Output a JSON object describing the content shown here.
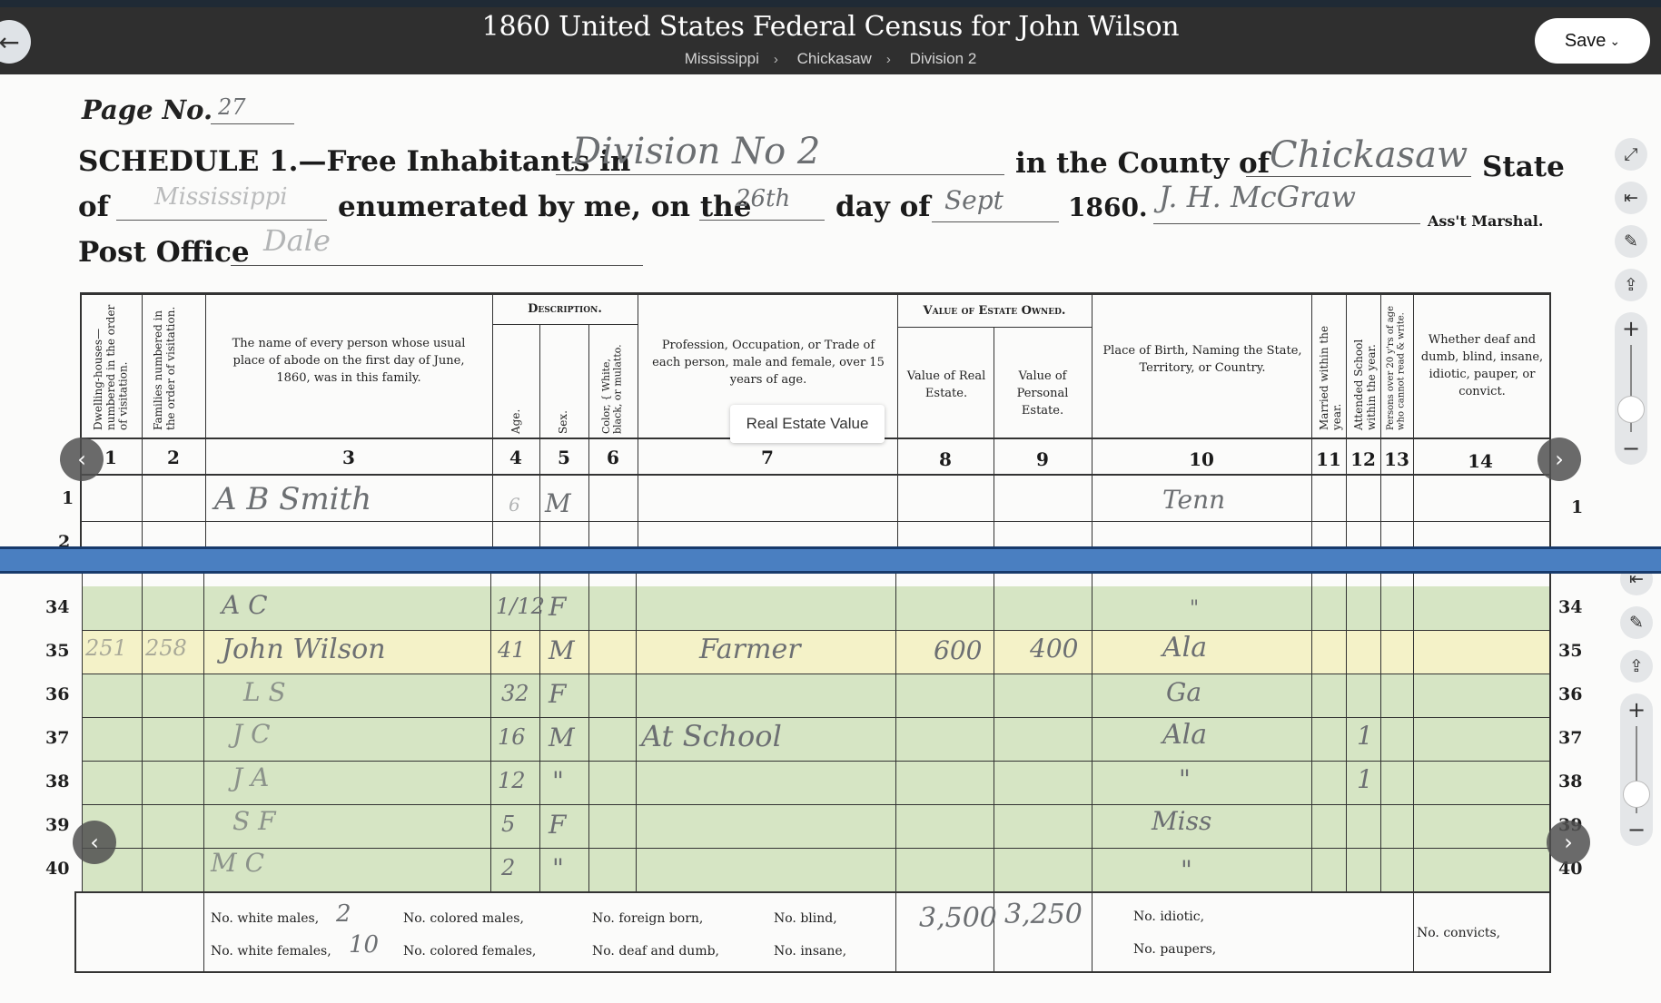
{
  "header": {
    "title": "1860 United States Federal Census for John Wilson",
    "breadcrumbs": [
      "Mississippi",
      "Chickasaw",
      "Division 2"
    ],
    "save_label": "Save",
    "back_icon": "arrow-left-icon"
  },
  "tooltip": "Real Estate Value",
  "document": {
    "page_label": "Page No.",
    "page_value": "27",
    "schedule_prefix": "SCHEDULE 1.—Free Inhabitants in",
    "division": "Division No 2",
    "county_label": "in the County of",
    "county": "Chickasaw",
    "state_label": "State",
    "of_label": "of",
    "state": "Mississippi",
    "enumerated_label": "enumerated by me, on the",
    "day": "26th",
    "day_label": "day of",
    "month": "Sept",
    "year": "1860.",
    "marshal": "J. H. McGraw",
    "marshal_label": "Ass't Marshal.",
    "post_office_label": "Post Office",
    "post_office": "Dale",
    "group_description": "Description.",
    "group_value": "Value of Estate Owned.",
    "col_headers": {
      "c1": "Dwelling-houses— numbered in the order of visitation.",
      "c2": "Families numbered in the order of visitation.",
      "c3": "The name of every person whose usual place of abode on the first day of June, 1860, was in this family.",
      "c4": "Age.",
      "c5": "Sex.",
      "c6": "Color, { White, black, or mulatto.",
      "c7": "Profession, Occupation, or Trade of each person, male and female, over 15 years of age.",
      "c8": "Value of Real Estate.",
      "c9": "Value of Personal Estate.",
      "c10": "Place of Birth, Naming the State, Territory, or Country.",
      "c11": "Married within the year.",
      "c12": "Attended School within the year.",
      "c13": "Persons over 20 y'rs of age who cannot read & write.",
      "c14": "Whether deaf and dumb, blind, insane, idiotic, pauper, or convict."
    },
    "col_numbers": [
      "1",
      "2",
      "3",
      "4",
      "5",
      "6",
      "7",
      "8",
      "9",
      "10",
      "11",
      "12",
      "13",
      "14"
    ],
    "upper_rows": [
      {
        "num": "1",
        "name": "A B Smith",
        "age": "6",
        "sex": "M",
        "birth": "Tenn"
      },
      {
        "num": "2"
      }
    ],
    "rows": [
      {
        "num": "34",
        "name": "A C",
        "age": "1/12",
        "sex": "F",
        "occupation": "",
        "real": "",
        "personal": "",
        "birth": "\"",
        "school": ""
      },
      {
        "num": "35",
        "dwelling": "251",
        "family": "258",
        "name": "John Wilson",
        "age": "41",
        "sex": "M",
        "occupation": "Farmer",
        "real": "600",
        "personal": "400",
        "birth": "Ala",
        "school": "",
        "highlight": true
      },
      {
        "num": "36",
        "name": "L S",
        "age": "32",
        "sex": "F",
        "occupation": "",
        "real": "",
        "personal": "",
        "birth": "Ga",
        "school": ""
      },
      {
        "num": "37",
        "name": "J C",
        "age": "16",
        "sex": "M",
        "occupation": "At School",
        "real": "",
        "personal": "",
        "birth": "Ala",
        "school": "1"
      },
      {
        "num": "38",
        "name": "J A",
        "age": "12",
        "sex": "\"",
        "occupation": "",
        "real": "",
        "personal": "",
        "birth": "\"",
        "school": "1"
      },
      {
        "num": "39",
        "name": "S F",
        "age": "5",
        "sex": "F",
        "occupation": "",
        "real": "",
        "personal": "",
        "birth": "Miss",
        "school": ""
      },
      {
        "num": "40",
        "name": "M C",
        "age": "2",
        "sex": "\"",
        "occupation": "",
        "real": "",
        "personal": "",
        "birth": "\"",
        "school": ""
      }
    ],
    "footer": {
      "white_males_label": "No. white males,",
      "white_males": "2",
      "white_females_label": "No. white females,",
      "white_females": "10",
      "colored_males_label": "No. colored males,",
      "colored_females_label": "No. colored females,",
      "foreign_born_label": "No. foreign born,",
      "deaf_dumb_label": "No. deaf and dumb,",
      "blind_label": "No. blind,",
      "insane_label": "No. insane,",
      "real_total": "3,500",
      "personal_total": "3,250",
      "idiotic_label": "No. idiotic,",
      "paupers_label": "No. paupers,",
      "convicts_label": "No. convicts,"
    }
  },
  "tools": {
    "icons": [
      "expand-icon",
      "collapse-left-icon",
      "wrench-icon",
      "share-icon"
    ],
    "zoom_in": "+",
    "zoom_out": "−",
    "upper_zoom_level": 0.3,
    "lower_zoom_level": 0.35
  }
}
